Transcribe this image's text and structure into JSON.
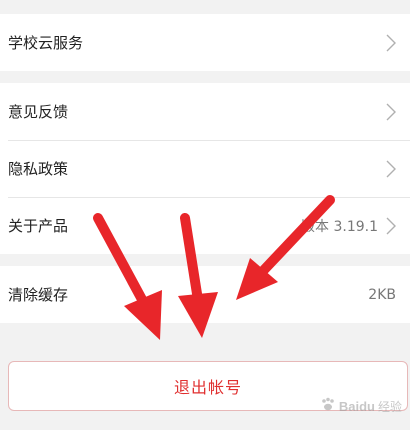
{
  "groups": [
    {
      "items": [
        {
          "label": "学校云服务",
          "value": "",
          "chevron": true
        }
      ]
    },
    {
      "items": [
        {
          "label": "意见反馈",
          "value": "",
          "chevron": true
        },
        {
          "label": "隐私政策",
          "value": "",
          "chevron": true
        },
        {
          "label": "关于产品",
          "value": "版本 3.19.1",
          "chevron": true
        }
      ]
    },
    {
      "items": [
        {
          "label": "清除缓存",
          "value": "2KB",
          "chevron": false
        }
      ]
    }
  ],
  "logout": {
    "label": "退出帐号"
  },
  "watermark": {
    "brand": "Baidu",
    "sub": "经验"
  },
  "colors": {
    "background": "#f2f2f2",
    "arrow": "#e8262a",
    "logout_text": "#e03030",
    "logout_border": "#e7b8b8"
  },
  "icons": {
    "chevron": "chevron-right-icon",
    "arrow": "red-arrow-annotation-icon",
    "watermark": "baidu-paw-icon"
  }
}
